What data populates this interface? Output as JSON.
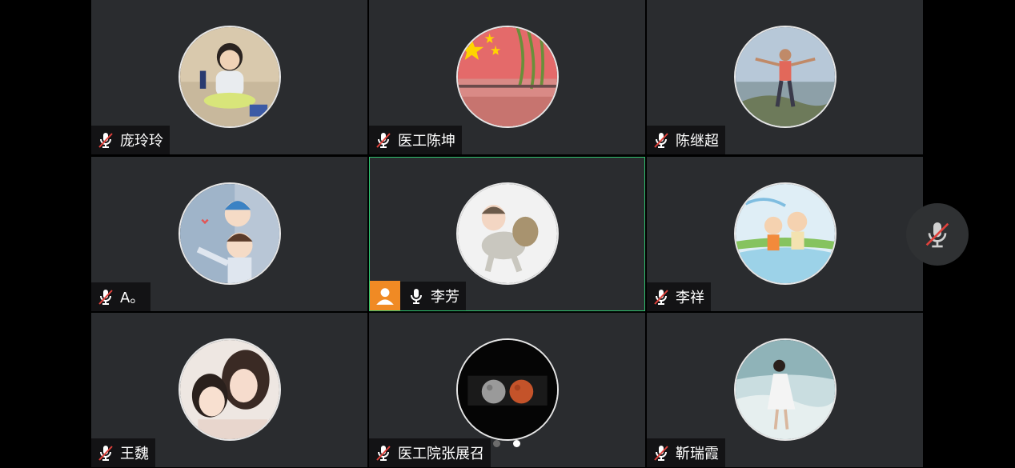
{
  "participants": [
    {
      "name": "庞玲玲",
      "muted": true,
      "host": false,
      "avatar": "child-drawing-photo"
    },
    {
      "name": "医工陈坤",
      "muted": true,
      "host": false,
      "avatar": "flag-lake-photo"
    },
    {
      "name": "陈继超",
      "muted": true,
      "host": false,
      "avatar": "man-arms-open-photo"
    },
    {
      "name": "A。",
      "muted": true,
      "host": false,
      "avatar": "cartoon-family-illustration"
    },
    {
      "name": "李芳",
      "muted": false,
      "host": true,
      "speaking": true,
      "avatar": "baby-with-basket-photo"
    },
    {
      "name": "李祥",
      "muted": true,
      "host": false,
      "avatar": "cartoon-kids-running"
    },
    {
      "name": "王魏",
      "muted": true,
      "host": false,
      "avatar": "mother-daughter-photo"
    },
    {
      "name": "医工院张展召",
      "muted": true,
      "host": false,
      "avatar": "moon-mars-2020"
    },
    {
      "name": "靳瑞霞",
      "muted": true,
      "host": false,
      "avatar": "woman-at-beach-photo"
    }
  ],
  "side_control": {
    "icon": "mic-muted-icon",
    "state": "muted"
  },
  "pager": {
    "pages": 2,
    "current": 2
  },
  "colors": {
    "tile_bg": "#2a2c2f",
    "active_border": "#2ec16e",
    "host_badge": "#f08a24",
    "mute_red": "#e0413b"
  }
}
